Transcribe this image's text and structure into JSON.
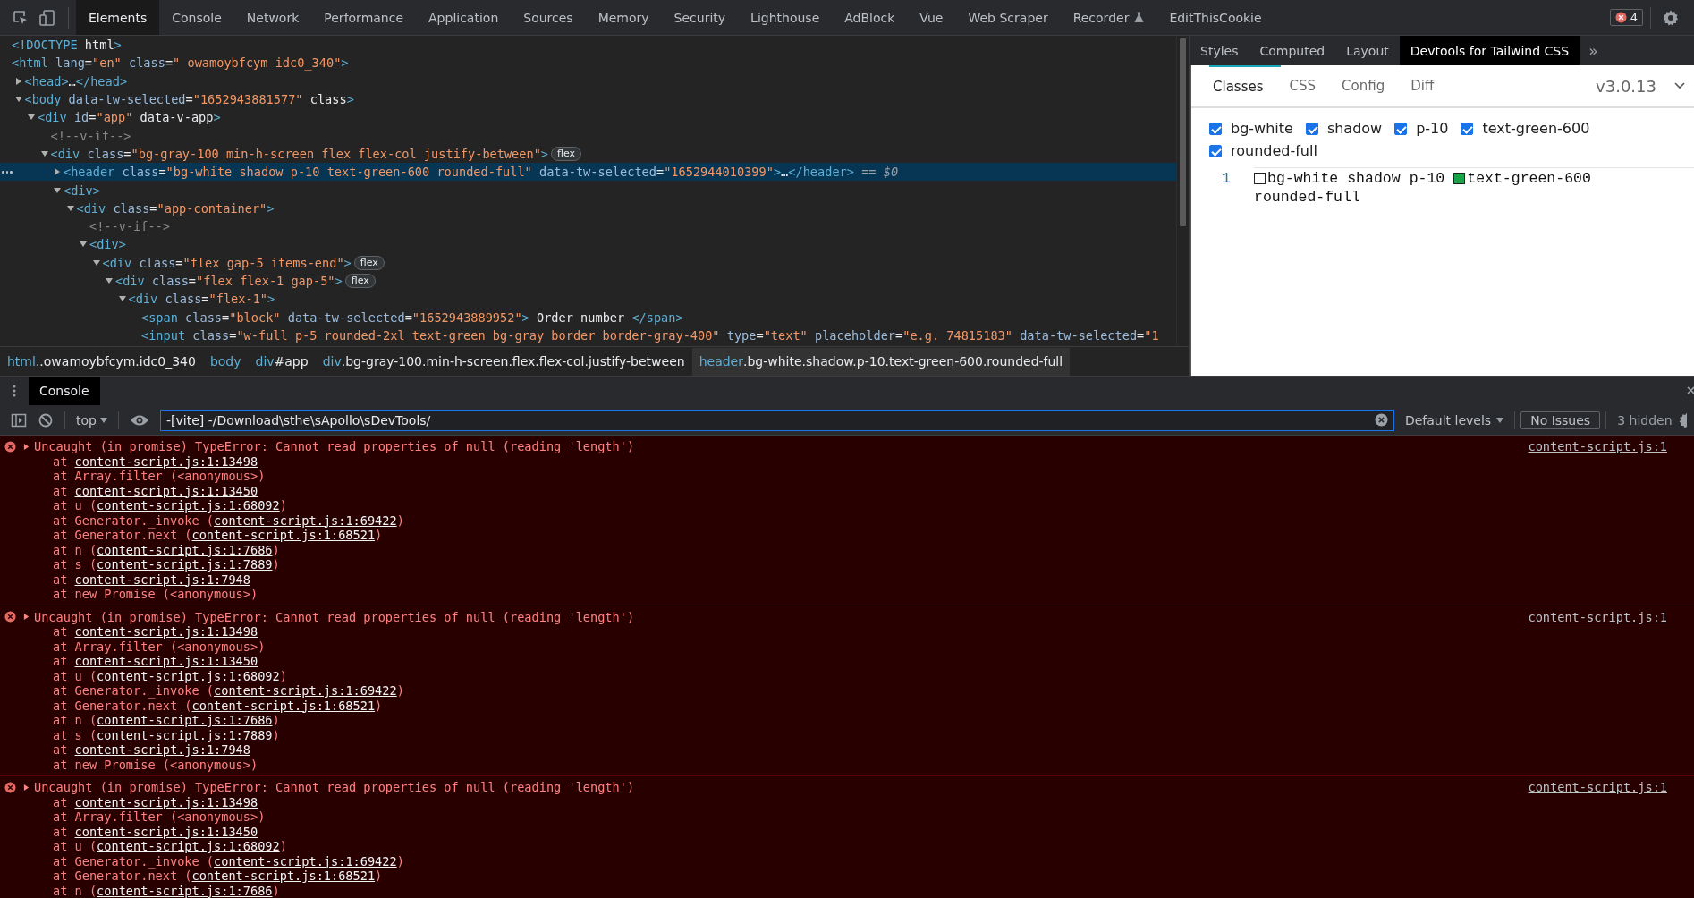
{
  "toolbar": {
    "tabs": [
      {
        "label": "Elements",
        "selected": true
      },
      {
        "label": "Console",
        "selected": false
      },
      {
        "label": "Network",
        "selected": false
      },
      {
        "label": "Performance",
        "selected": false
      },
      {
        "label": "Application",
        "selected": false
      },
      {
        "label": "Sources",
        "selected": false
      },
      {
        "label": "Memory",
        "selected": false
      },
      {
        "label": "Security",
        "selected": false
      },
      {
        "label": "Lighthouse",
        "selected": false
      },
      {
        "label": "AdBlock",
        "selected": false
      },
      {
        "label": "Vue",
        "selected": false
      },
      {
        "label": "Web Scraper",
        "selected": false
      },
      {
        "label": "Recorder",
        "selected": false,
        "kind": "flask"
      },
      {
        "label": "EditThisCookie",
        "selected": false
      }
    ],
    "error_count": "4"
  },
  "elements": {
    "nodes": [
      {
        "text": "<!DOCTYPE html>",
        "selected": false
      },
      {
        "text": "<html lang=\"en\" class=\" owamoybfcym idc0_340\">",
        "selected": false,
        "children": [
          {
            "text": "<head>…</head>",
            "expanded": false,
            "selected": false
          },
          {
            "text": "<body data-tw-selected=\"1652943881577\" class>",
            "expanded": true,
            "selected": false,
            "children": [
              {
                "text": "<div id=\"app\" data-v-app>",
                "expanded": true,
                "selected": false,
                "children": [
                  {
                    "text": "<!--v-if-->",
                    "selected": false
                  },
                  {
                    "text": "<div class=\"bg-gray-100 min-h-screen flex flex-col justify-between\">",
                    "expanded": true,
                    "selected": false,
                    "badge": "flex",
                    "children": [
                      {
                        "text": "<header class=\"bg-white shadow p-10 text-green-600 rounded-full\" data-tw-selected=\"1652944010399\">…</header> == $0",
                        "expanded": false,
                        "selected": true
                      },
                      {
                        "text": "<div>",
                        "expanded": true,
                        "selected": false,
                        "children": [
                          {
                            "text": "<div class=\"app-container\">",
                            "expanded": true,
                            "selected": false,
                            "children": [
                              {
                                "text": "<!--v-if-->",
                                "selected": false
                              },
                              {
                                "text": "<div>",
                                "expanded": true,
                                "selected": false,
                                "children": [
                                  {
                                    "text": "<div class=\"flex gap-5 items-end\">",
                                    "expanded": true,
                                    "selected": false,
                                    "badge": "flex",
                                    "children": [
                                      {
                                        "text": "<div class=\"flex flex-1 gap-5\">",
                                        "expanded": true,
                                        "selected": false,
                                        "badge": "flex",
                                        "children": [
                                          {
                                            "text": "<div class=\"flex-1\">",
                                            "expanded": true,
                                            "selected": false,
                                            "children": [
                                              {
                                                "text": "<span class=\"block\" data-tw-selected=\"1652943889952\"> Order number </span>",
                                                "selected": false
                                              },
                                              {
                                                "text": "<input class=\"w-full p-5 rounded-2xl text-green bg-gray border border-gray-400\" type=\"text\" placeholder=\"e.g. 74815183\" data-tw-selected=\"1",
                                                "selected": false
                                              }
                                            ]
                                          }
                                        ]
                                      }
                                    ]
                                  }
                                ]
                              }
                            ]
                          }
                        ]
                      }
                    ]
                  }
                ]
              }
            ]
          }
        ]
      }
    ],
    "breadcrumbs": [
      {
        "label": "html..owamoybfcym.idc0_340",
        "selected": false
      },
      {
        "label": "body",
        "selected": false
      },
      {
        "label": "div#app",
        "selected": false
      },
      {
        "label": "div.bg-gray-100.min-h-screen.flex.flex-col.justify-between",
        "selected": false
      },
      {
        "label": "header.bg-white.shadow.p-10.text-green-600.rounded-full",
        "selected": true
      }
    ]
  },
  "sidebar": {
    "tabs": [
      {
        "label": "Styles",
        "selected": false
      },
      {
        "label": "Computed",
        "selected": false
      },
      {
        "label": "Layout",
        "selected": false
      },
      {
        "label": "Devtools for Tailwind CSS",
        "selected": true
      }
    ],
    "overflow": "»",
    "tailwind": {
      "tabs": [
        {
          "label": "Classes",
          "selected": true
        },
        {
          "label": "CSS",
          "selected": false
        },
        {
          "label": "Config",
          "selected": false
        },
        {
          "label": "Diff",
          "selected": false
        }
      ],
      "version": "v3.0.13",
      "classes": [
        {
          "label": "bg-white",
          "checked": true
        },
        {
          "label": "shadow",
          "checked": true
        },
        {
          "label": "p-10",
          "checked": true
        },
        {
          "label": "text-green-600",
          "checked": true
        },
        {
          "label": "rounded-full",
          "checked": true
        }
      ],
      "editor": {
        "line_number": "1",
        "tokens": [
          {
            "text": "bg-white",
            "color": "#ffffff"
          },
          {
            "text": "shadow"
          },
          {
            "text": "p-10"
          },
          {
            "text": "text-green-600",
            "color": "#16a34a"
          },
          {
            "text": "rounded-full"
          }
        ]
      }
    }
  },
  "drawer": {
    "tabs": [
      {
        "label": "Console",
        "selected": true
      }
    ],
    "context": "top",
    "filter": {
      "value": "-[vite] -/Download\\sthe\\sApollo\\sDevTools/"
    },
    "levels": "Default levels",
    "issues": "No Issues",
    "hidden": "3 hidden",
    "messages": [
      {
        "message": "Uncaught (in promise) TypeError: Cannot read properties of null (reading 'length')",
        "source": "content-script.js:1",
        "frames": [
          {
            "text": "at ",
            "link": "content-script.js:1:13498"
          },
          {
            "text": "at Array.filter (<anonymous>)"
          },
          {
            "text": "at ",
            "link": "content-script.js:1:13450"
          },
          {
            "text": "at u (",
            "link": "content-script.js:1:68092",
            "tail": ")"
          },
          {
            "text": "at Generator._invoke (",
            "link": "content-script.js:1:69422",
            "tail": ")"
          },
          {
            "text": "at Generator.next (",
            "link": "content-script.js:1:68521",
            "tail": ")"
          },
          {
            "text": "at n (",
            "link": "content-script.js:1:7686",
            "tail": ")"
          },
          {
            "text": "at s (",
            "link": "content-script.js:1:7889",
            "tail": ")"
          },
          {
            "text": "at ",
            "link": "content-script.js:1:7948"
          },
          {
            "text": "at new Promise (<anonymous>)"
          }
        ]
      },
      {
        "message": "Uncaught (in promise) TypeError: Cannot read properties of null (reading 'length')",
        "source": "content-script.js:1",
        "frames": [
          {
            "text": "at ",
            "link": "content-script.js:1:13498"
          },
          {
            "text": "at Array.filter (<anonymous>)"
          },
          {
            "text": "at ",
            "link": "content-script.js:1:13450"
          },
          {
            "text": "at u (",
            "link": "content-script.js:1:68092",
            "tail": ")"
          },
          {
            "text": "at Generator._invoke (",
            "link": "content-script.js:1:69422",
            "tail": ")"
          },
          {
            "text": "at Generator.next (",
            "link": "content-script.js:1:68521",
            "tail": ")"
          },
          {
            "text": "at n (",
            "link": "content-script.js:1:7686",
            "tail": ")"
          },
          {
            "text": "at s (",
            "link": "content-script.js:1:7889",
            "tail": ")"
          },
          {
            "text": "at ",
            "link": "content-script.js:1:7948"
          },
          {
            "text": "at new Promise (<anonymous>)"
          }
        ]
      },
      {
        "message": "Uncaught (in promise) TypeError: Cannot read properties of null (reading 'length')",
        "source": "content-script.js:1",
        "frames": [
          {
            "text": "at ",
            "link": "content-script.js:1:13498"
          },
          {
            "text": "at Array.filter (<anonymous>)"
          },
          {
            "text": "at ",
            "link": "content-script.js:1:13450"
          },
          {
            "text": "at u (",
            "link": "content-script.js:1:68092",
            "tail": ")"
          },
          {
            "text": "at Generator._invoke (",
            "link": "content-script.js:1:69422",
            "tail": ")"
          },
          {
            "text": "at Generator.next (",
            "link": "content-script.js:1:68521",
            "tail": ")"
          },
          {
            "text": "at n (",
            "link": "content-script.js:1:7686",
            "tail": ")"
          }
        ]
      }
    ]
  }
}
